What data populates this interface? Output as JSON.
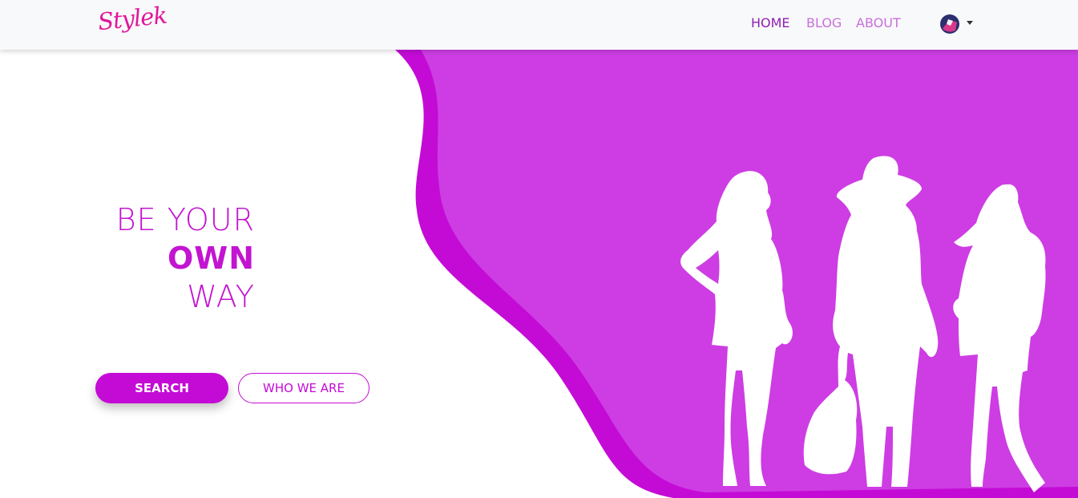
{
  "brand": {
    "logo_text": "Stylek"
  },
  "nav": {
    "home": "HOME",
    "blog": "BLOG",
    "about": "ABOUT",
    "active": "HOME"
  },
  "hero": {
    "line1": "BE YOUR",
    "line2": "OWN",
    "line3": "WAY",
    "primary_button": "SEARCH",
    "secondary_button": "WHO WE ARE",
    "image": "three-women-silhouettes"
  },
  "colors": {
    "brand_magenta": "#c40bd6",
    "hero_purple": "#cd3de3",
    "logo_pink": "#e0179b"
  }
}
